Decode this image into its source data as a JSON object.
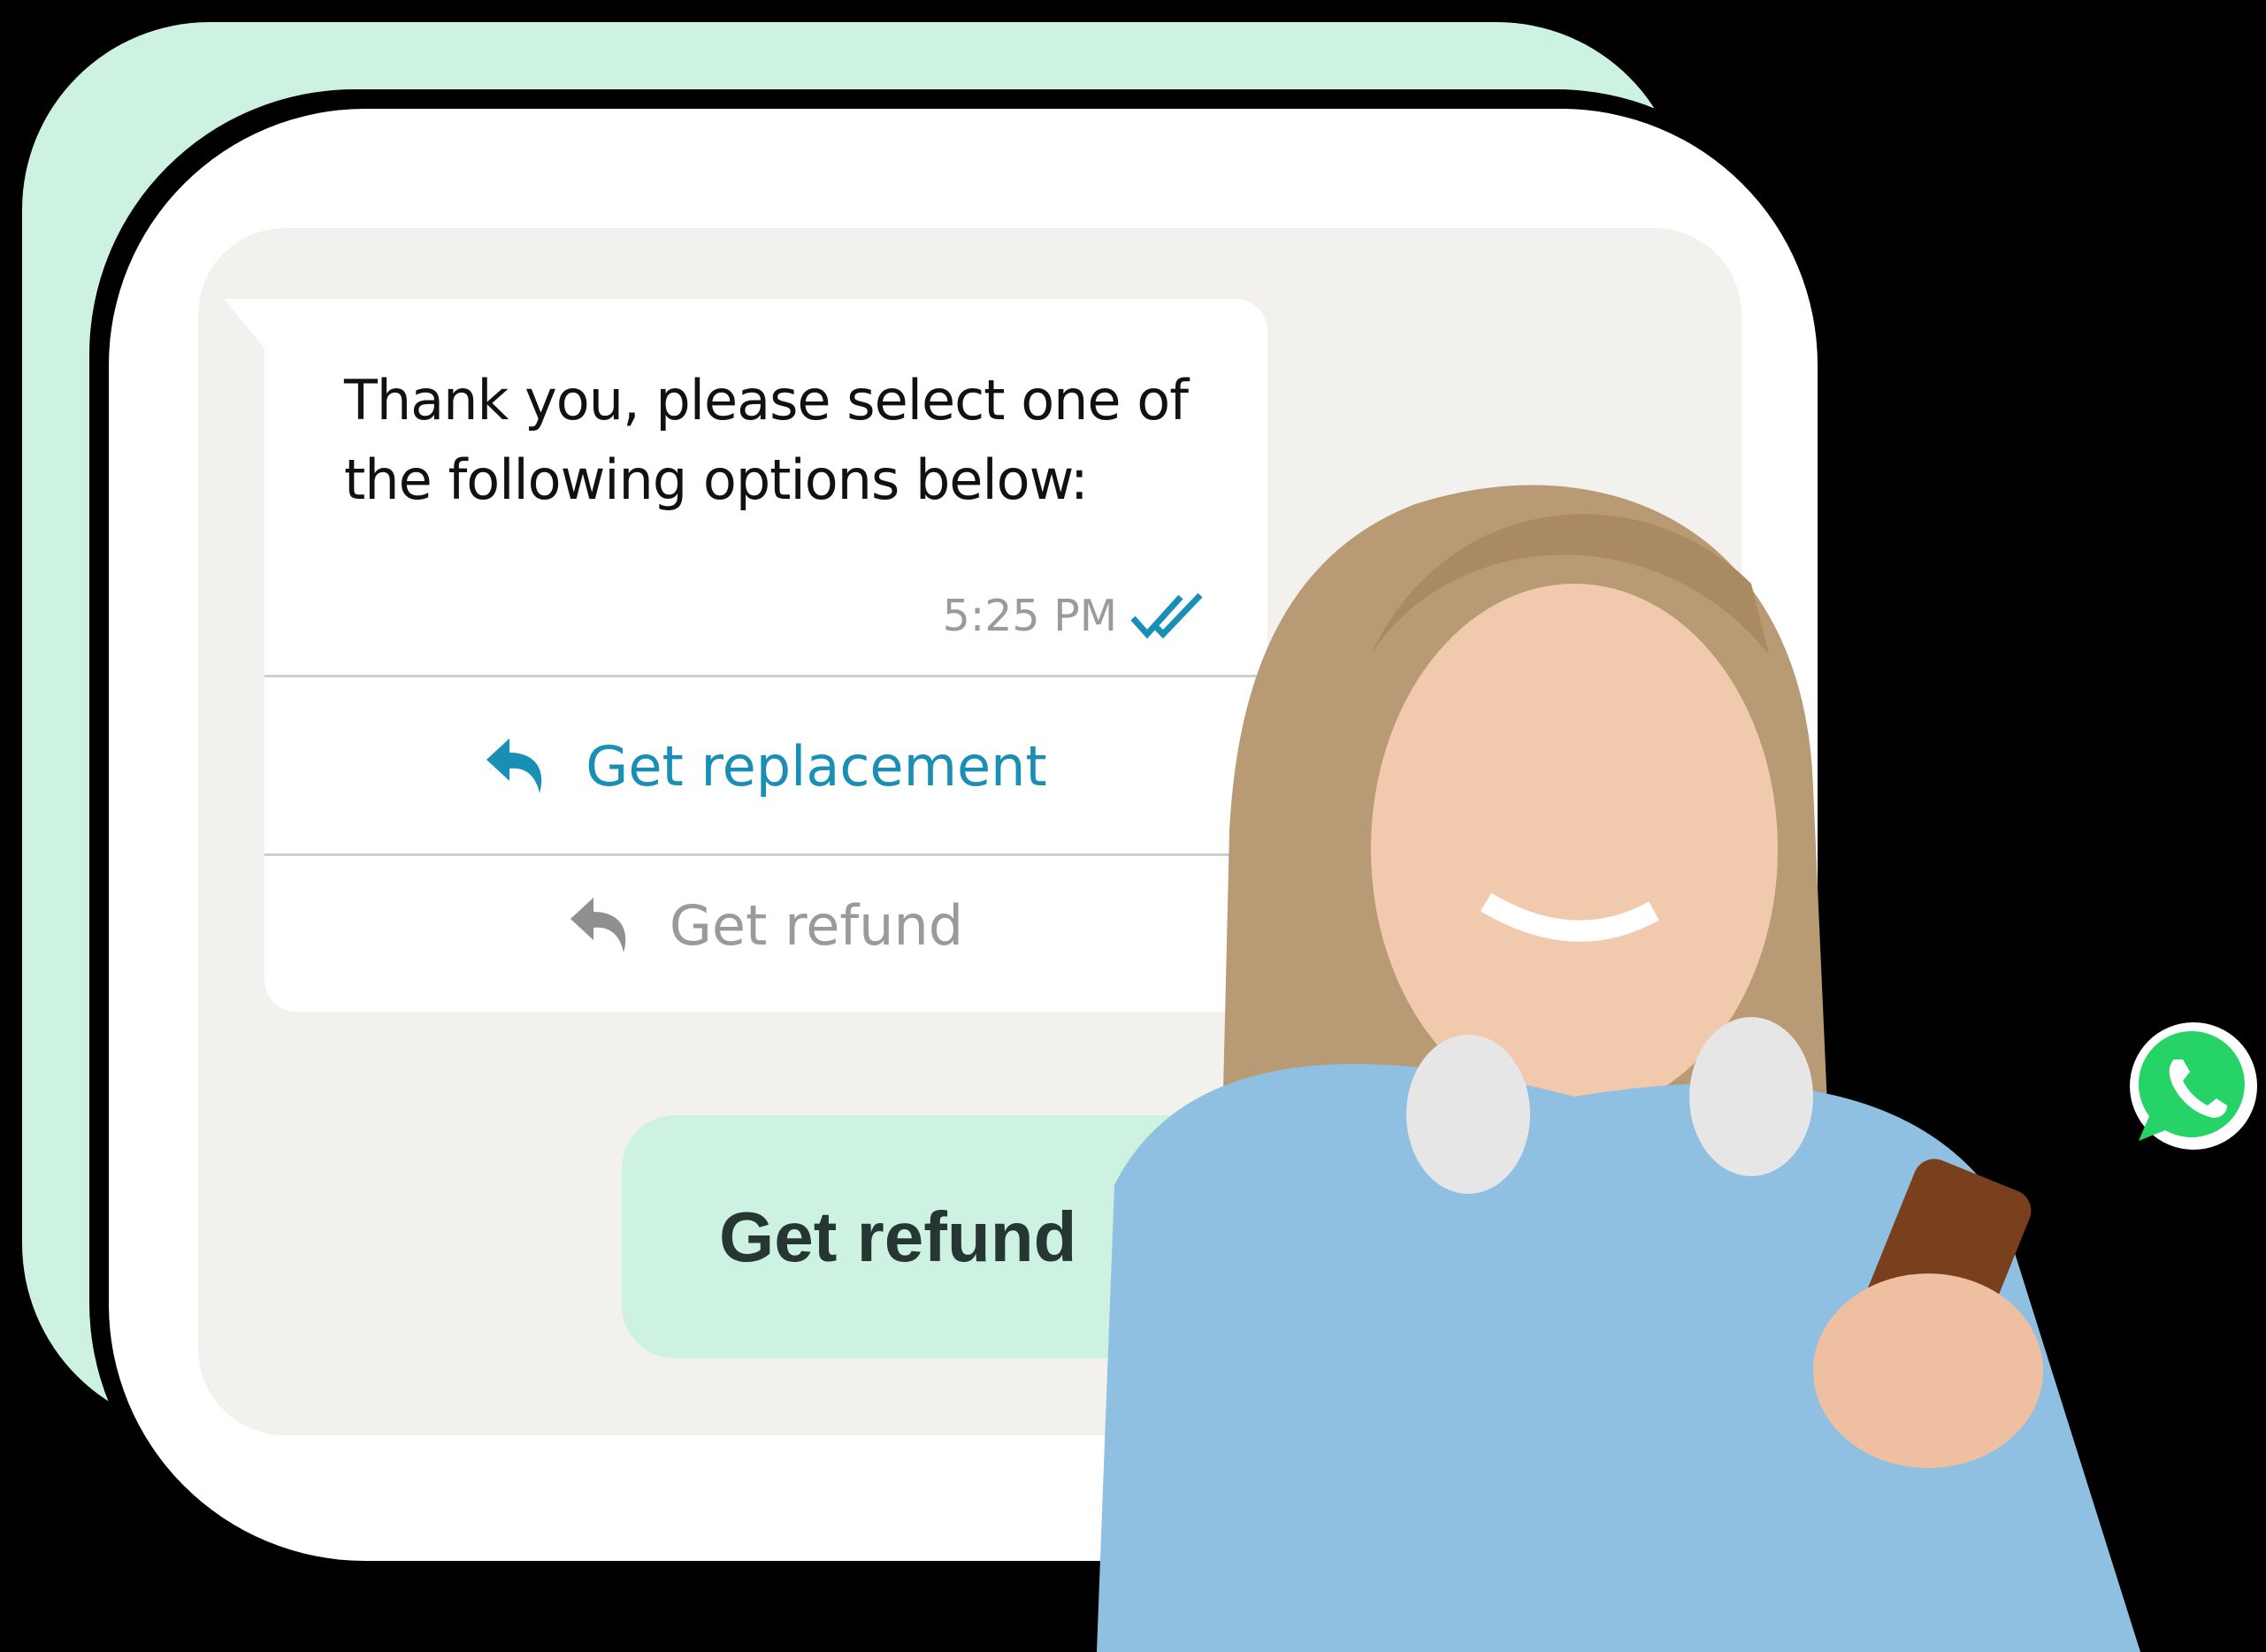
{
  "chat": {
    "message": "Thank you, please select one of the following options below:",
    "timestamp": "5:25 PM",
    "read_status_icon": "double-check-icon",
    "options": [
      {
        "label": "Get replacement",
        "icon": "reply-icon",
        "color": "#1a8fb5"
      },
      {
        "label": "Get refund",
        "icon": "reply-icon",
        "color": "#9a9a9a"
      }
    ],
    "sent_reply": "Get refund"
  },
  "colors": {
    "mint": "#cdf2e1",
    "panel": "#f2f1ee",
    "accent": "#1a8fb5",
    "whatsapp": "#25d366"
  },
  "badge_icon": "whatsapp-icon"
}
